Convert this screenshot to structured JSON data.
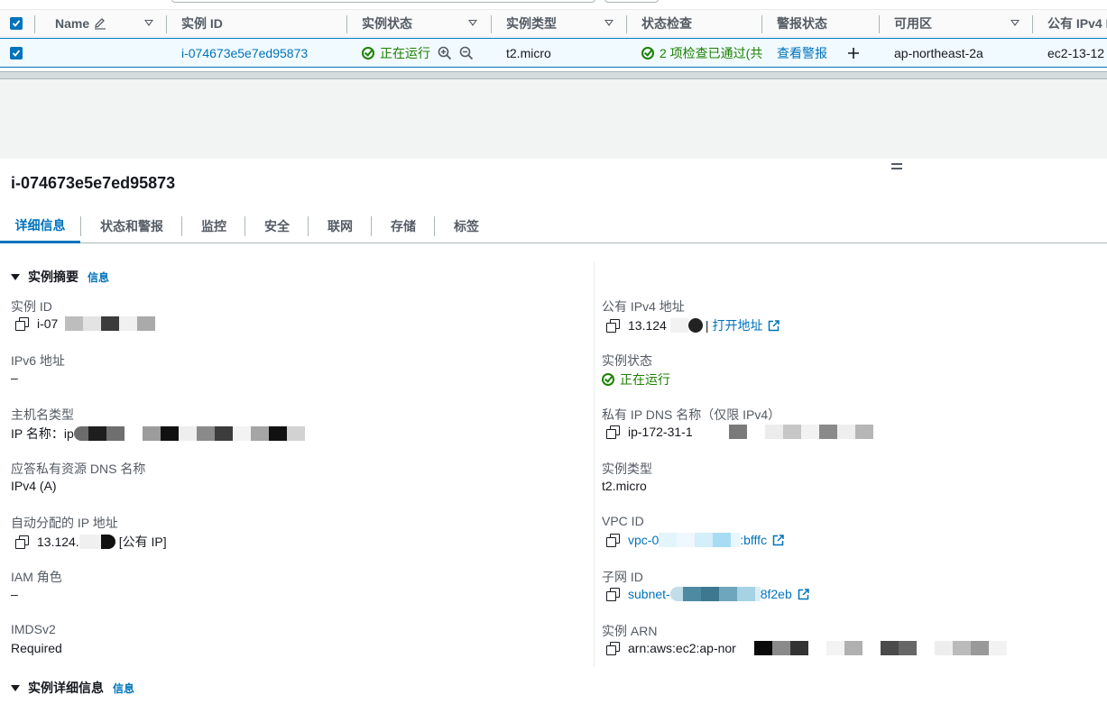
{
  "table": {
    "headers": {
      "name": "Name",
      "instance_id": "实例 ID",
      "instance_state": "实例状态",
      "instance_type": "实例类型",
      "status_check": "状态检查",
      "alarm_status": "警报状态",
      "availability_zone": "可用区",
      "public_ipv4": "公有 IPv4 I"
    },
    "row": {
      "name": "",
      "instance_id": "i-074673e5e7ed95873",
      "instance_state": "正在运行",
      "instance_type": "t2.micro",
      "status_check": "2 项检查已通过(共",
      "alarm_status": "查看警报",
      "availability_zone": "ap-northeast-2a",
      "public_ipv4": "ec2-13-12"
    }
  },
  "detail": {
    "title": "i-074673e5e7ed95873",
    "tabs": [
      "详细信息",
      "状态和警报",
      "监控",
      "安全",
      "联网",
      "存储",
      "标签"
    ],
    "summary_section": {
      "title": "实例摘要",
      "info": "信息"
    },
    "details_section": {
      "title": "实例详细信息",
      "info": "信息"
    },
    "left_fields": {
      "instance_id": {
        "label": "实例 ID",
        "value": "i-07"
      },
      "ipv6": {
        "label": "IPv6 地址",
        "value": "–"
      },
      "hostname_type": {
        "label": "主机名类型",
        "value": "IP 名称：ip"
      },
      "dns_answer": {
        "label": "应答私有资源 DNS 名称",
        "value": "IPv4 (A)"
      },
      "auto_ip": {
        "label": "自动分配的 IP 地址",
        "value": "13.124.",
        "suffix": "[公有 IP]"
      },
      "iam_role": {
        "label": "IAM 角色",
        "value": "–"
      },
      "imdsv2": {
        "label": "IMDSv2",
        "value": "Required"
      }
    },
    "right_fields": {
      "public_ipv4": {
        "label": "公有 IPv4 地址",
        "value": "13.124",
        "sep": "|",
        "open_link": "打开地址"
      },
      "instance_state": {
        "label": "实例状态",
        "value": "正在运行"
      },
      "private_dns": {
        "label": "私有 IP DNS 名称（仅限 IPv4）",
        "value": "ip-172-31-1"
      },
      "instance_type": {
        "label": "实例类型",
        "value": "t2.micro"
      },
      "vpc_id": {
        "label": "VPC ID",
        "value_start": "vpc-0",
        "value_end": ":bfffc"
      },
      "subnet_id": {
        "label": "子网 ID",
        "value_start": "subnet-",
        "value_end": "8f2eb"
      },
      "arn": {
        "label": "实例 ARN",
        "value": "arn:aws:ec2:ap-nor"
      }
    }
  },
  "colors": {
    "accent": "#0073bb",
    "success": "#1d8102"
  }
}
